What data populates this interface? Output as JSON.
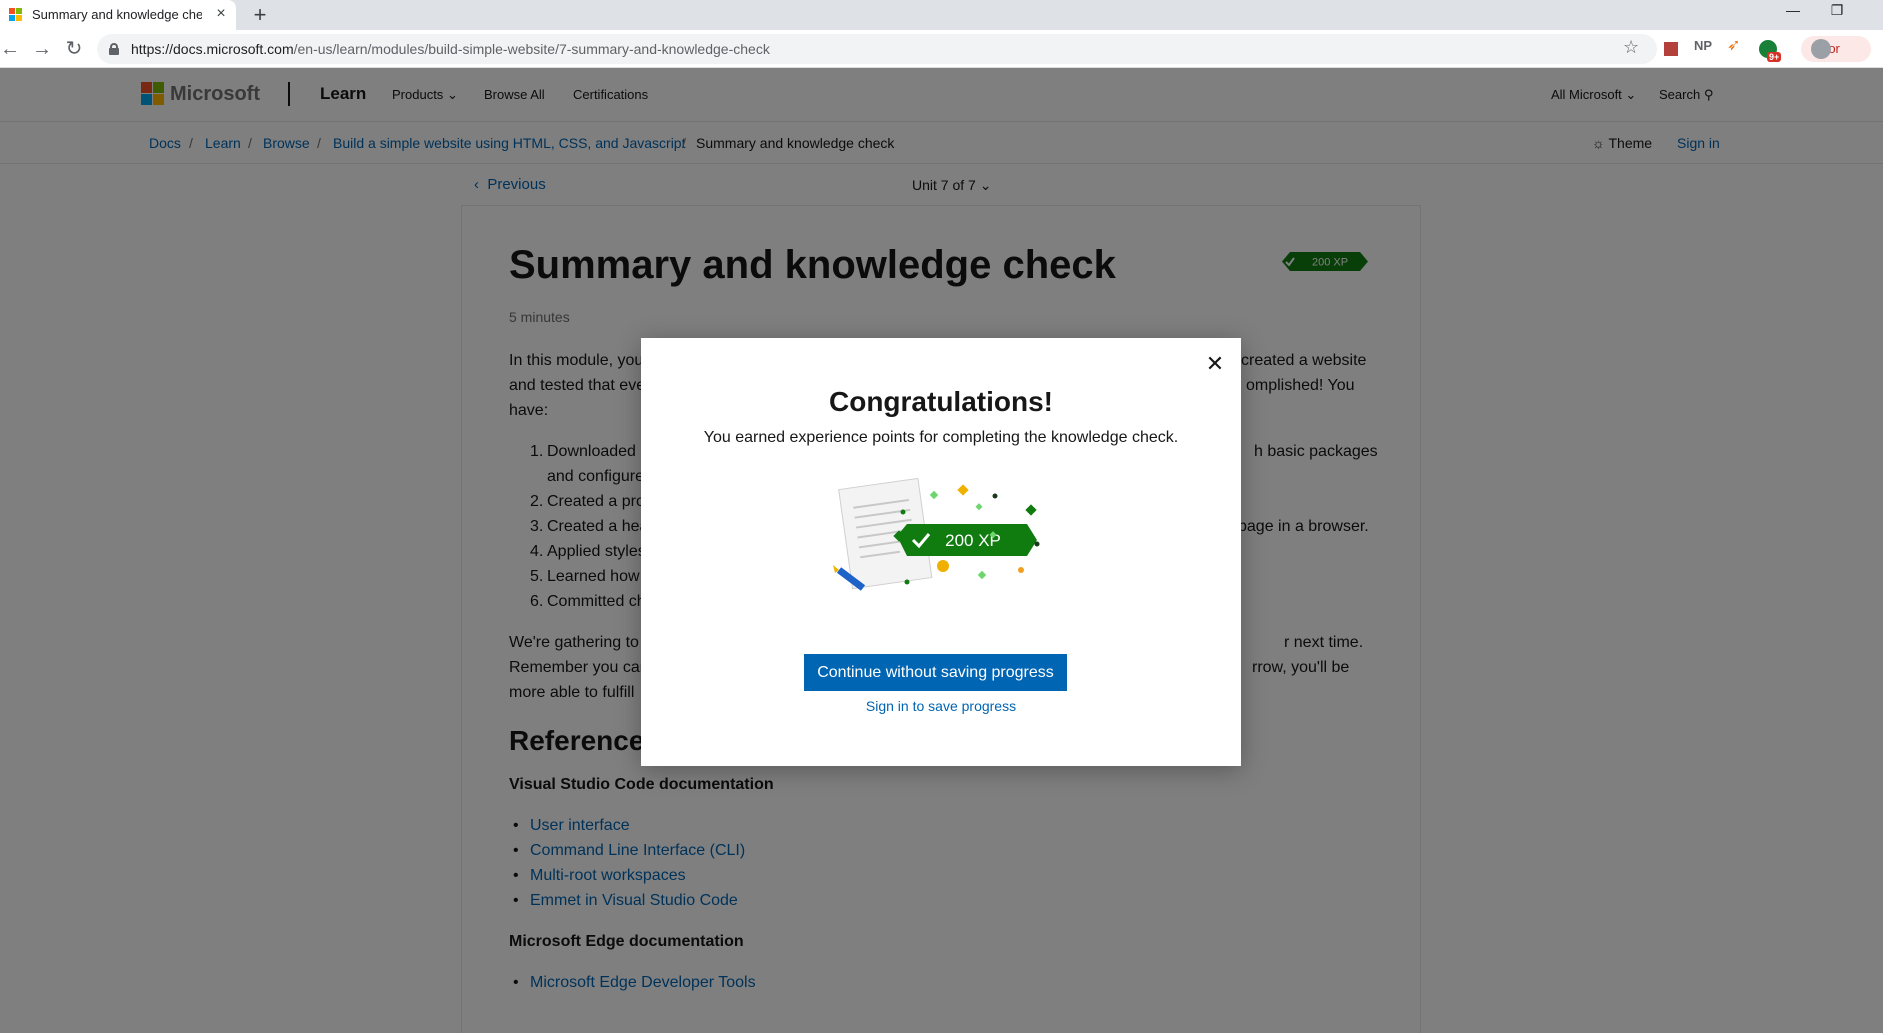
{
  "browser": {
    "tab_title": "Summary and knowledge check",
    "url_host": "https://docs.microsoft.com",
    "url_path": "/en-us/learn/modules/build-simple-website/7-summary-and-knowledge-check",
    "ext_np": "NP",
    "ext_badge": "9+",
    "error_label": "Error"
  },
  "header": {
    "brand": "Microsoft",
    "learn": "Learn",
    "nav": [
      "Products",
      "Browse All",
      "Certifications"
    ],
    "all_microsoft": "All Microsoft",
    "search": "Search"
  },
  "breadcrumb": {
    "items": [
      "Docs",
      "Learn",
      "Browse",
      "Build a simple website using HTML, CSS, and Javascript",
      "Summary and knowledge check"
    ],
    "theme": "Theme",
    "sign_in": "Sign in"
  },
  "unit_nav": {
    "previous": "Previous",
    "unit": "Unit 7 of 7"
  },
  "article": {
    "title": "Summary and knowledge check",
    "xp": "200 XP",
    "duration": "5 minutes",
    "intro_line1_a": "In this module, you",
    "intro_line1_b": "created a website",
    "intro_line2_a": "and tested that eve",
    "intro_line2_b": "omplished! You",
    "intro_line3": "have:",
    "list": [
      {
        "left": "Downloaded",
        "right": "h basic packages"
      },
      {
        "left": "and configure",
        "right": ""
      },
      {
        "left": "Created a pro",
        "right": ""
      },
      {
        "left": "Created a hea",
        "right": "page in a browser."
      },
      {
        "left": "Applied styles",
        "right": ""
      },
      {
        "left": "Learned how",
        "right": ""
      },
      {
        "left": "Committed ch",
        "right": ""
      }
    ],
    "numbers": [
      "1.",
      "2.",
      "3.",
      "4.",
      "5.",
      "6."
    ],
    "gather_line1_a": "We're gathering to",
    "gather_line1_b": "r next time.",
    "gather_line2_a": "Remember you car",
    "gather_line2_b": "rrow, you'll be",
    "gather_line3_a": "more able to fulfill",
    "references_heading": "Reference",
    "vscode_heading": "Visual Studio Code documentation",
    "vscode_links": [
      "User interface",
      "Command Line Interface (CLI)",
      "Multi-root workspaces",
      "Emmet in Visual Studio Code"
    ],
    "edge_heading": "Microsoft Edge documentation",
    "edge_links": [
      "Microsoft Edge Developer Tools"
    ]
  },
  "modal": {
    "title": "Congratulations!",
    "subtitle": "You earned experience points for completing the knowledge check.",
    "xp": "200 XP",
    "primary_button": "Continue without saving progress",
    "secondary_link": "Sign in to save progress"
  },
  "colors": {
    "accent": "#0065b3",
    "xp_green": "#107c10"
  }
}
